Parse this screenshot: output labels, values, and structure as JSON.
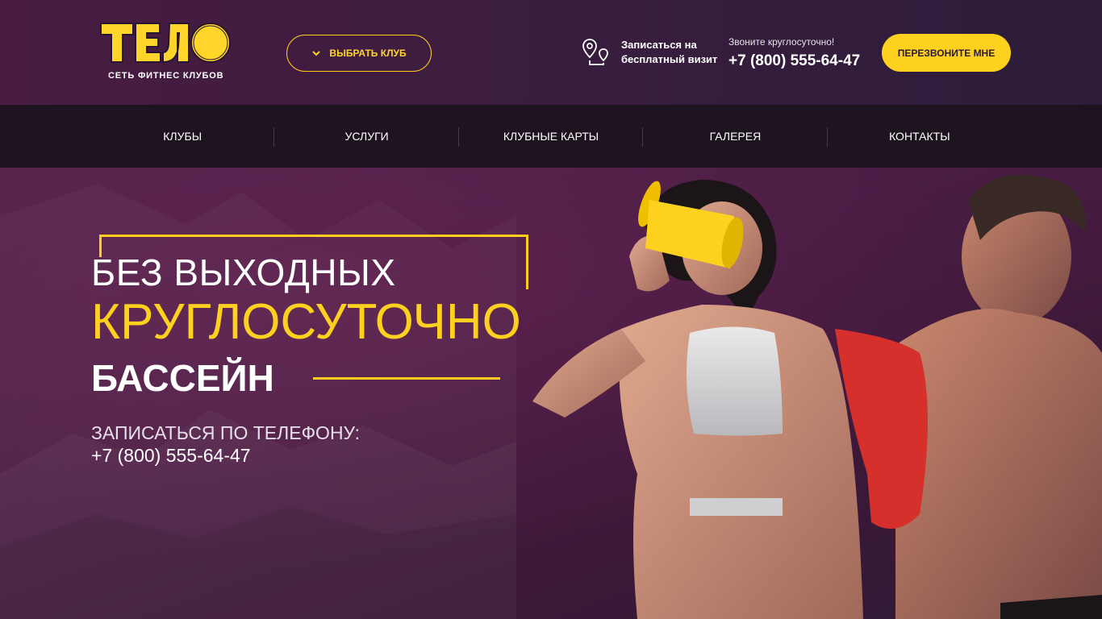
{
  "header": {
    "logo": {
      "title": "ТЕЛО",
      "subtitle": "СЕТЬ ФИТНЕС КЛУБОВ"
    },
    "choose_club_label": "ВЫБРАТЬ КЛУБ",
    "visit": {
      "line1": "Записаться на",
      "line2": "бесплатный визит",
      "icon": "map-pin-route-icon"
    },
    "phone": {
      "label": "Звоните круглосуточно!",
      "number": "+7 (800) 555-64-47"
    },
    "callback_label": "ПЕРЕЗВОНИТЕ МНЕ"
  },
  "nav": {
    "items": [
      {
        "label": "КЛУБЫ"
      },
      {
        "label": "УСЛУГИ"
      },
      {
        "label": "КЛУБНЫЕ КАРТЫ"
      },
      {
        "label": "ГАЛЕРЕЯ"
      },
      {
        "label": "КОНТАКТЫ"
      }
    ]
  },
  "hero": {
    "line1": "БЕЗ ВЫХОДНЫХ",
    "line2": "КРУГЛОСУТОЧНО",
    "line3": "БАССЕЙН",
    "call_label": "ЗАПИСАТЬСЯ ПО ТЕЛЕФОНУ:",
    "call_phone": "+7 (800) 555-64-47"
  },
  "colors": {
    "accent": "#ffd11f",
    "nav_bg": "#1e1420",
    "hero_bg": "#4b1d45",
    "header_bg": "#3b1d3f"
  }
}
